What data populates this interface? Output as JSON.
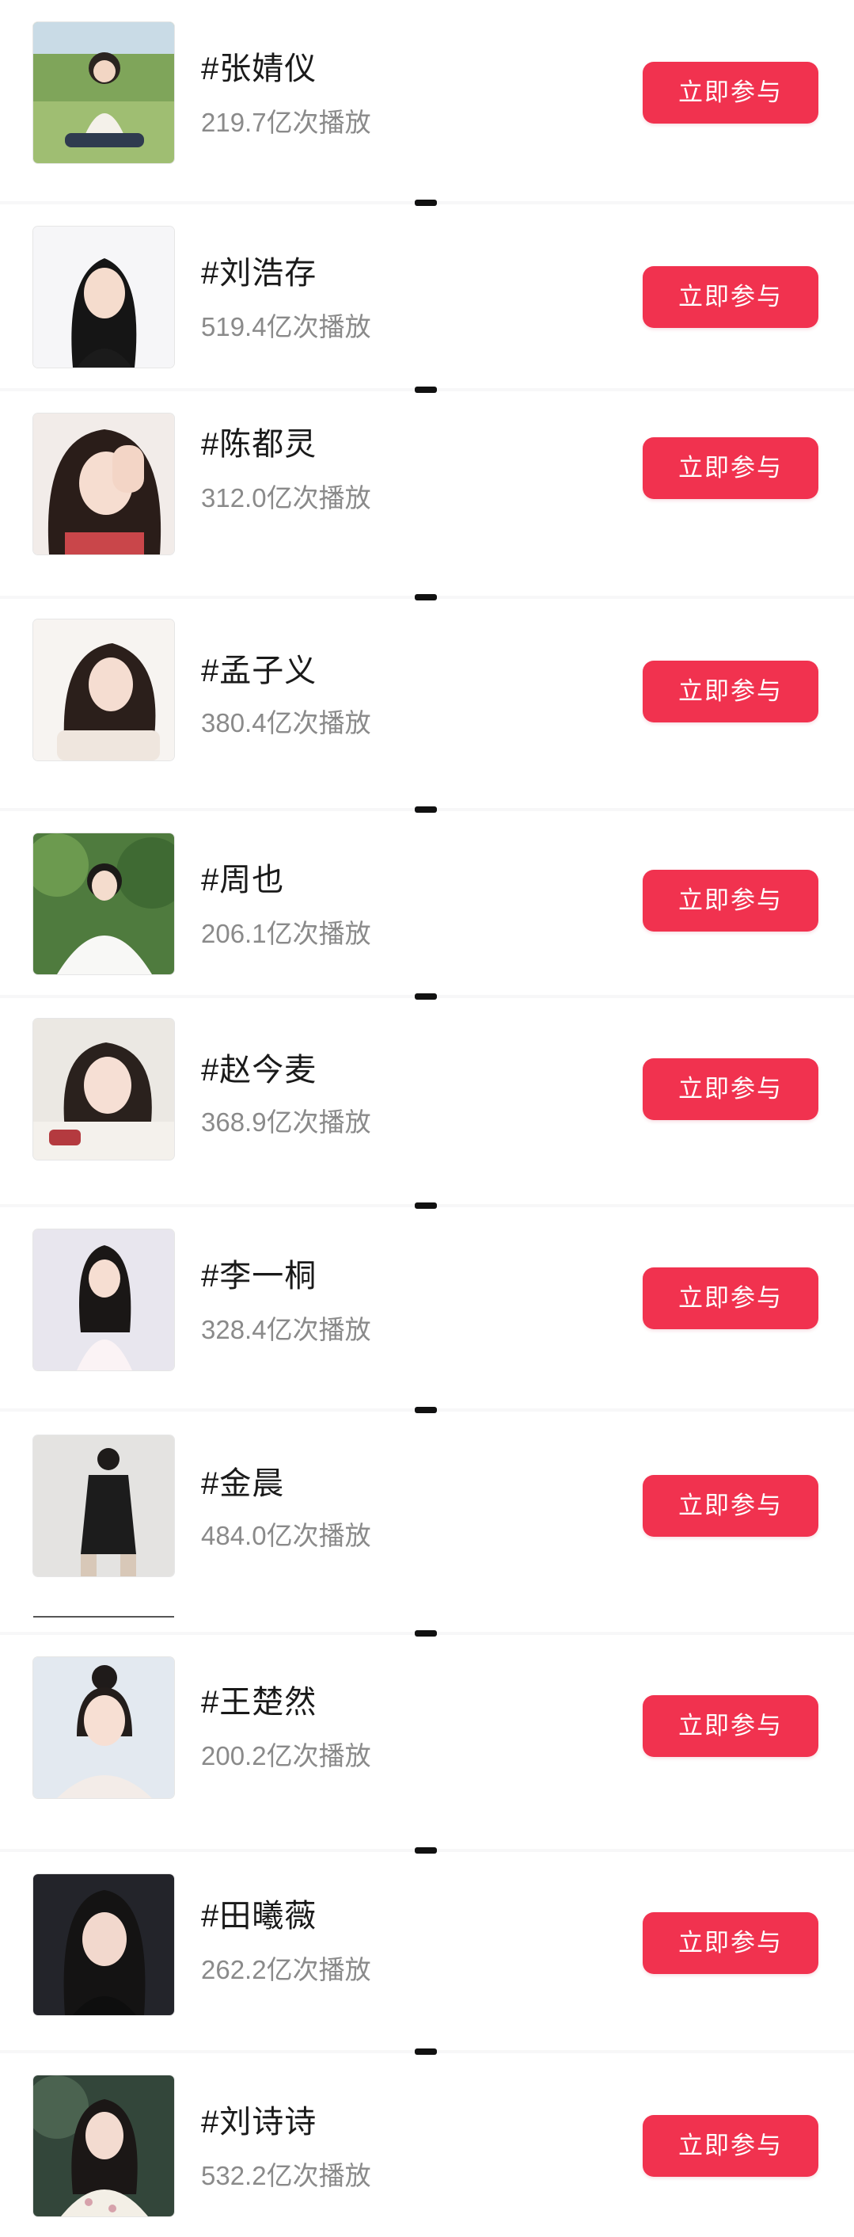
{
  "topics": [
    {
      "name": "#张婧仪",
      "plays": "219.7亿次播放",
      "button": "立即参与",
      "avatar_icon": "portrait-sitting-grass"
    },
    {
      "name": "#刘浩存",
      "plays": "519.4亿次播放",
      "button": "立即参与",
      "avatar_icon": "portrait-black-hair"
    },
    {
      "name": "#陈都灵",
      "plays": "312.0亿次播放",
      "button": "立即参与",
      "avatar_icon": "portrait-hand-on-face"
    },
    {
      "name": "#孟子义",
      "plays": "380.4亿次播放",
      "button": "立即参与",
      "avatar_icon": "portrait-leaning"
    },
    {
      "name": "#周也",
      "plays": "206.1亿次播放",
      "button": "立即参与",
      "avatar_icon": "portrait-white-dress-trees"
    },
    {
      "name": "#赵今麦",
      "plays": "368.9亿次播放",
      "button": "立即参与",
      "avatar_icon": "portrait-table"
    },
    {
      "name": "#李一桐",
      "plays": "328.4亿次播放",
      "button": "立即参与",
      "avatar_icon": "portrait-white-dress"
    },
    {
      "name": "#金晨",
      "plays": "484.0亿次播放",
      "button": "立即参与",
      "avatar_icon": "portrait-black-outfit"
    },
    {
      "name": "#王楚然",
      "plays": "200.2亿次播放",
      "button": "立即参与",
      "avatar_icon": "portrait-hair-bun"
    },
    {
      "name": "#田曦薇",
      "plays": "262.2亿次播放",
      "button": "立即参与",
      "avatar_icon": "portrait-dark"
    },
    {
      "name": "#刘诗诗",
      "plays": "532.2亿次播放",
      "button": "立即参与",
      "avatar_icon": "portrait-floral"
    }
  ],
  "colors": {
    "accent": "#f1324f",
    "name_text": "#1a1a1a",
    "plays_text": "#8a8a8a",
    "background": "#f7f7f8"
  }
}
